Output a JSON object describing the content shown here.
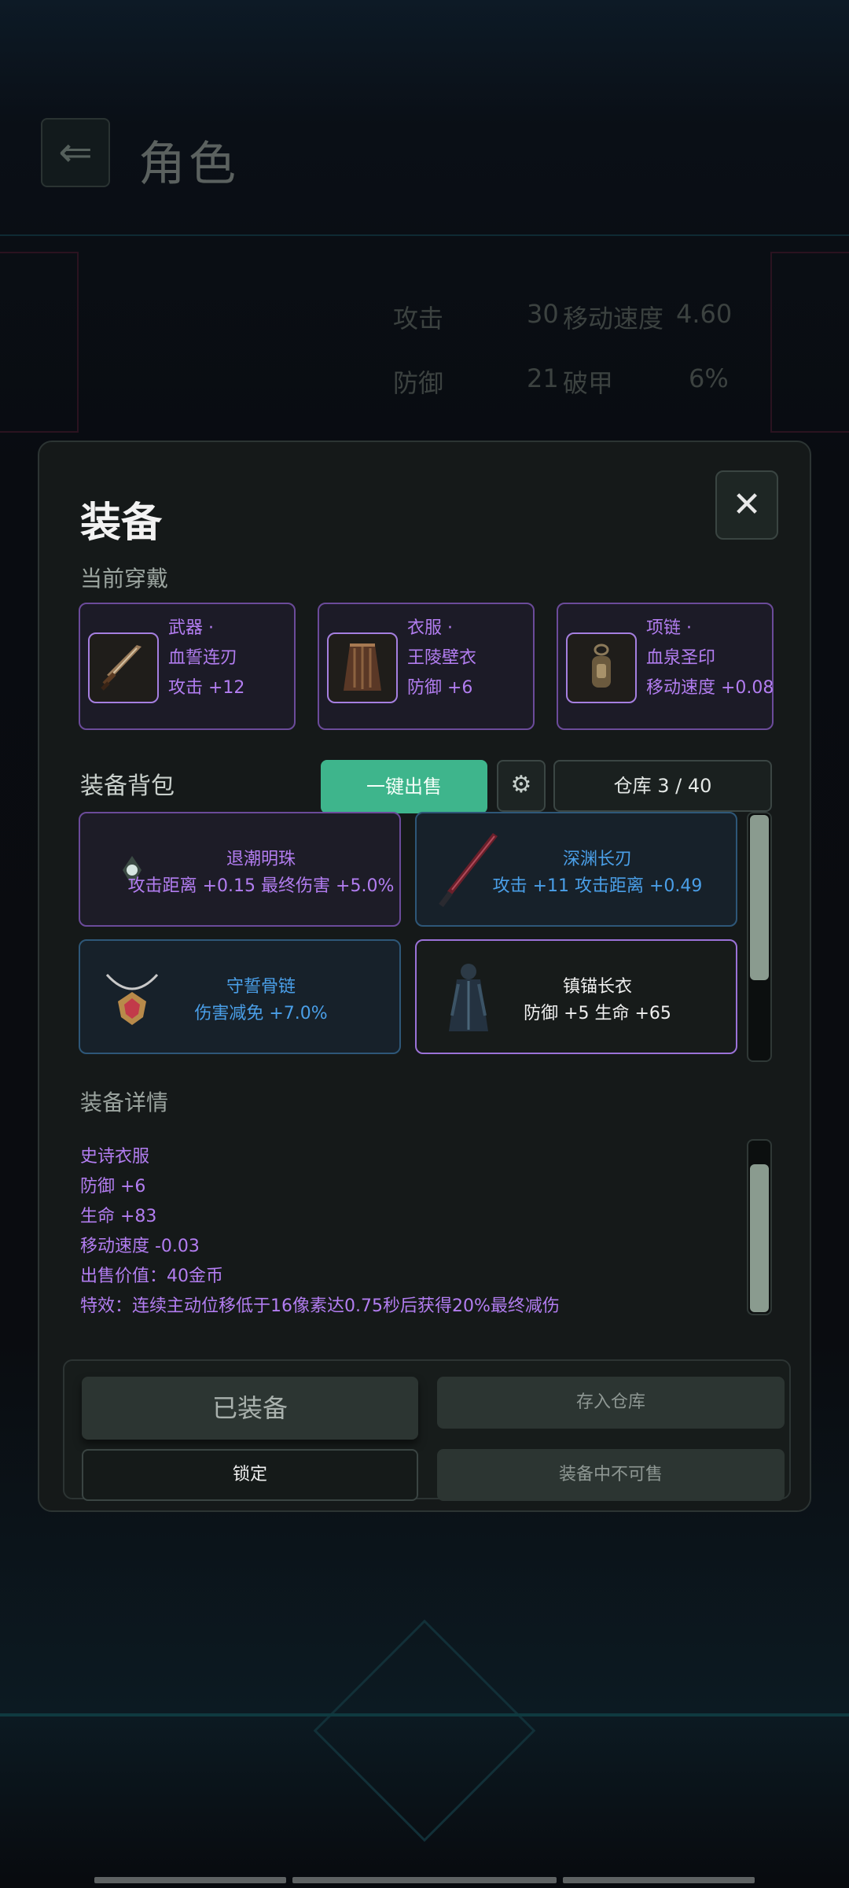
{
  "background": {
    "title": "角色",
    "back_icon": "arrow-left-icon",
    "stats": [
      {
        "label": "攻击",
        "value": "30"
      },
      {
        "label": "移动速度",
        "value": "4.60"
      },
      {
        "label": "防御",
        "value": "21"
      },
      {
        "label": "破甲",
        "value": "6%"
      }
    ]
  },
  "modal": {
    "title": "装备",
    "close_icon": "close-icon",
    "current_label": "当前穿戴",
    "slots": [
      {
        "type": "武器 ·",
        "name": "血誓连刃",
        "stat": "攻击 +12",
        "icon": "sword-icon"
      },
      {
        "type": "衣服 ·",
        "name": "王陵壁衣",
        "stat": "防御 +6",
        "icon": "robe-icon"
      },
      {
        "type": "项链 ·",
        "name": "血泉圣印",
        "stat": "移动速度 +0.08",
        "icon": "seal-icon"
      }
    ],
    "bag": {
      "label": "装备背包",
      "sell_all": "一键出售",
      "settings_icon": "gear-icon",
      "storage": "仓库 3 / 40",
      "items": [
        {
          "name": "退潮明珠",
          "stats": "攻击距离 +0.15  最终伤害 +5.0%",
          "rarity": "epic",
          "icon": "pearl-icon"
        },
        {
          "name": "深渊长刃",
          "stats": "攻击 +11  攻击距离 +0.49",
          "rarity": "rare",
          "icon": "blade-icon"
        },
        {
          "name": "守誓骨链",
          "stats": "伤害减免 +7.0%",
          "rarity": "rare",
          "icon": "necklace-icon"
        },
        {
          "name": "镇锚长衣",
          "stats": "防御 +5  生命 +65",
          "rarity": "selected",
          "icon": "coat-icon"
        }
      ]
    },
    "detail": {
      "label": "装备详情",
      "lines": [
        "史诗衣服",
        "防御 +6",
        "生命 +83",
        "移动速度 -0.03",
        "出售价值：40金币",
        "特效：连续主动位移低于16像素达0.75秒后获得20%最终减伤"
      ]
    },
    "actions": {
      "equipped": "已装备",
      "store": "存入仓库",
      "lock": "锁定",
      "cannot_sell": "装备中不可售"
    }
  },
  "colors": {
    "epic": "#b27df0",
    "rare": "#4a9fe8",
    "accent_green": "#3eb58c"
  }
}
